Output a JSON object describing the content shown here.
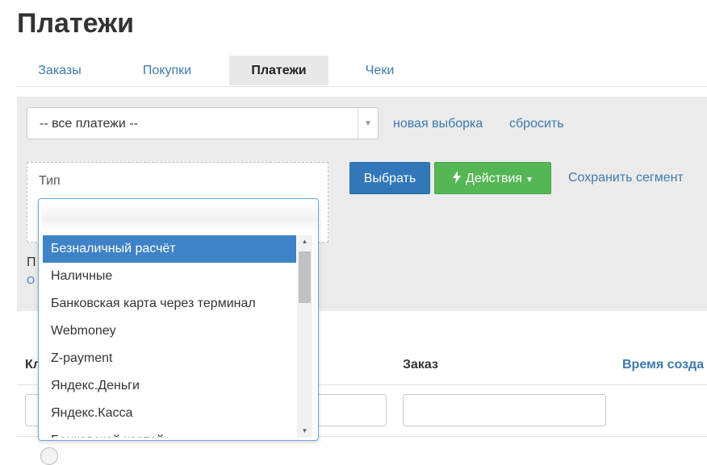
{
  "page": {
    "title": "Платежи"
  },
  "tabs": [
    {
      "label": "Заказы",
      "active": false
    },
    {
      "label": "Покупки",
      "active": false
    },
    {
      "label": "Платежи",
      "active": true
    },
    {
      "label": "Чеки",
      "active": false
    }
  ],
  "filters": {
    "select_value": "-- все платежи --",
    "new_selection_link": "новая выборка",
    "reset_link": "сбросить",
    "type_label": "Тип",
    "select_button": "Выбрать",
    "actions_button": "Действия",
    "save_segment_link": "Сохранить сегмент",
    "hidden_text_1": "П",
    "hidden_text_2": "О"
  },
  "dropdown": {
    "search_value": "",
    "options": [
      "Безналичный расчёт",
      "Наличные",
      "Банковская карта через терминал",
      "Webmoney",
      "Z-payment",
      "Яндекс.Деньги",
      "Яндекс.Касса",
      "Банковской картой"
    ],
    "highlighted_index": 0
  },
  "table": {
    "headers": {
      "client": "Кл",
      "order": "Заказ",
      "created": "Время созда"
    }
  },
  "colors": {
    "accent_blue": "#3277b8",
    "link_blue": "#3e79ad",
    "success_green": "#55b655",
    "highlight": "#3e83c7",
    "panel_bg": "#ebebeb"
  },
  "icons": {
    "actions": "lightning-icon",
    "caret": "caret-down-icon"
  }
}
